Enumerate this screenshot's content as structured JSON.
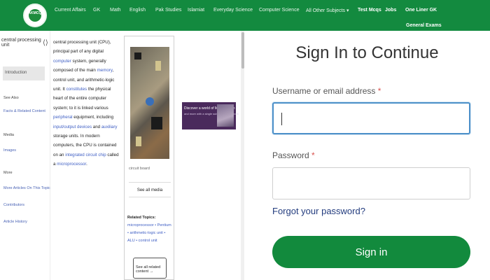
{
  "nav": {
    "items": [
      "Current Affairs",
      "GK",
      "Math",
      "English",
      "Pak Studies",
      "Islamiat",
      "Everyday Science",
      "Computer Science",
      "All Other Subjects ▾",
      "Test Mcqs",
      "Jobs",
      "One Liner GK"
    ],
    "sub_item": "General Exams",
    "logo_text": "PAKMCQS"
  },
  "sidebar": {
    "search_value": "central processing unit",
    "active_item": "Introduction",
    "see_all_label": "See Also",
    "see_all_link": "Facts & Related Content",
    "media_label": "Media",
    "media_link": "Images",
    "more_label": "More",
    "more_links": [
      "More Articles On This Topic",
      "Contributors",
      "Article History"
    ]
  },
  "article": {
    "segments": [
      {
        "t": "central processing unit (CPU), principal part of any digital ",
        "link": false
      },
      {
        "t": "computer",
        "link": true
      },
      {
        "t": " system, generally composed of the main ",
        "link": false
      },
      {
        "t": "memory",
        "link": true
      },
      {
        "t": ", control unit, and arithmetic-logic unit. It ",
        "link": false
      },
      {
        "t": "constitutes",
        "link": true
      },
      {
        "t": " the physical heart of the entire computer system; to it is linked various ",
        "link": false
      },
      {
        "t": "peripheral",
        "link": true
      },
      {
        "t": " equipment, including ",
        "link": false
      },
      {
        "t": "input/output devices",
        "link": true
      },
      {
        "t": " and ",
        "link": false
      },
      {
        "t": "auxiliary",
        "link": true
      },
      {
        "t": " storage units. In modern computers, the CPU is contained on an ",
        "link": false
      },
      {
        "t": "integrated circuit chip",
        "link": true
      },
      {
        "t": " called a ",
        "link": false
      },
      {
        "t": "microprocessor",
        "link": true
      },
      {
        "t": ".",
        "link": false
      }
    ]
  },
  "thumb": {
    "caption": "circuit board",
    "see_all_media": "See all media",
    "related_label": "Related Topics:",
    "related_links": "microprocessor • Pentium • arithmetic-logic unit • ALU • control unit",
    "see_all_related": "See all related content →"
  },
  "ad": {
    "title": "Discover a world of Microsoft fun",
    "subtitle": "and more with a single subscription to find it"
  },
  "signin": {
    "title": "Sign In to Continue",
    "username_label": "Username or email address",
    "username_value": "",
    "password_label": "Password",
    "password_value": "",
    "required_mark": "*",
    "forgot_link": "Forgot your password?",
    "submit_label": "Sign in"
  },
  "colors": {
    "nav_bg": "#138a3f",
    "button_bg": "#128a3d",
    "link": "#233c7e",
    "focus_border": "#4c90c9",
    "required": "#d9534f"
  }
}
